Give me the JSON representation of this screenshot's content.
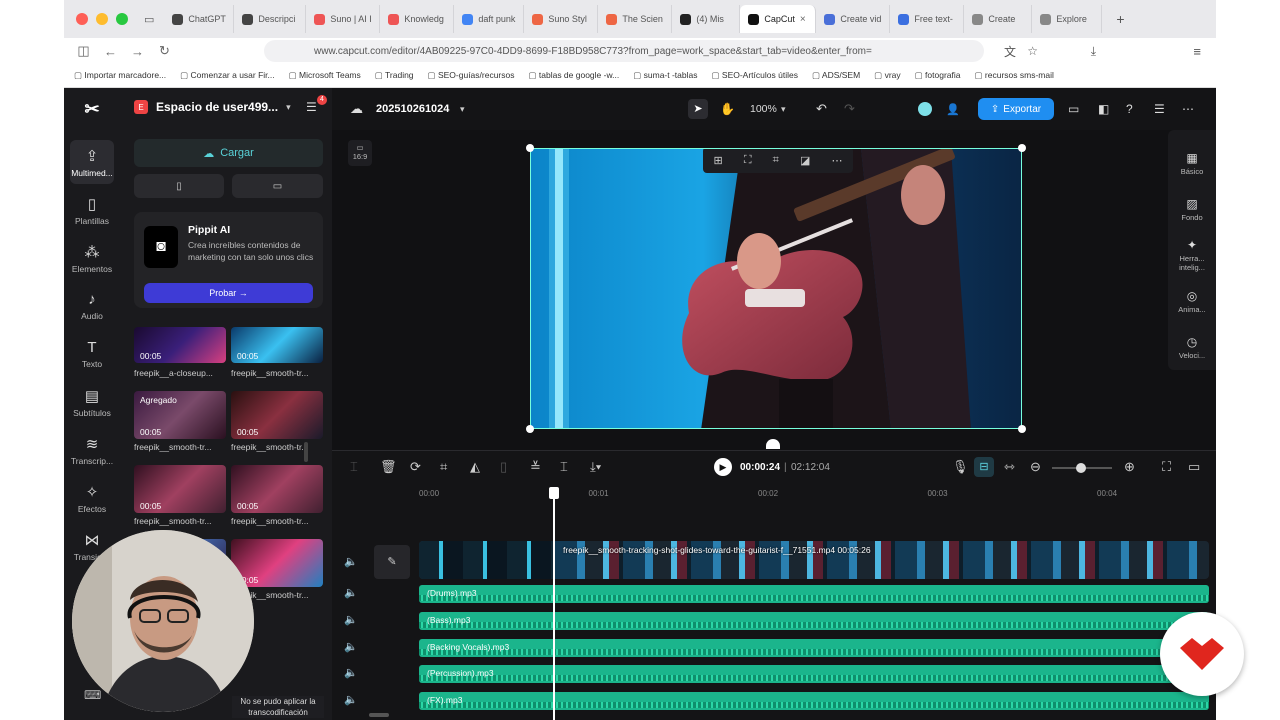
{
  "browser": {
    "tabs": [
      {
        "label": "ChatGPT",
        "color": "#444"
      },
      {
        "label": "Descripci",
        "color": "#444"
      },
      {
        "label": "Suno | AI I",
        "color": "#e55"
      },
      {
        "label": "Knowledg",
        "color": "#e55"
      },
      {
        "label": "daft punk",
        "color": "#4285f4"
      },
      {
        "label": "Suno Styl",
        "color": "#e64"
      },
      {
        "label": "The Scien",
        "color": "#e64"
      },
      {
        "label": "(4)  Mis",
        "color": "#222"
      },
      {
        "label": "CapCut",
        "color": "#111",
        "active": true
      },
      {
        "label": "Create vid",
        "color": "#4a6fd8"
      },
      {
        "label": "Free text-",
        "color": "#3b6fe0"
      },
      {
        "label": "Create",
        "color": "#888"
      },
      {
        "label": "Explore",
        "color": "#888"
      }
    ],
    "url": "www.capcut.com/editor/4AB09225-97C0-4DD9-8699-F18BD958C773?from_page=work_space&start_tab=video&enter_from=",
    "bookmarks": [
      "Importar marcadore...",
      "Comenzar a usar Fir...",
      "Microsoft Teams",
      "Trading",
      "SEO-guías/recursos",
      "tablas de google -w...",
      "suma-t -tablas",
      "SEO-Artículos útiles",
      "ADS/SEM",
      "vray",
      "fotografia",
      "recursos sms-mail"
    ]
  },
  "rail": [
    {
      "icon": "⇪",
      "label": "Multimed...",
      "active": true
    },
    {
      "icon": "▯",
      "label": "Plantillas"
    },
    {
      "icon": "⁂",
      "label": "Elementos"
    },
    {
      "icon": "♪",
      "label": "Audio"
    },
    {
      "icon": "T",
      "label": "Texto"
    },
    {
      "icon": "▤",
      "label": "Subtítulos"
    },
    {
      "icon": "≋",
      "label": "Transcrip..."
    },
    {
      "icon": "✧",
      "label": "Efectos"
    },
    {
      "icon": "⋈",
      "label": "Transici..."
    }
  ],
  "side": {
    "workspace": "Espacio de user499...",
    "badge": "4",
    "upload": "Cargar",
    "promo_title": "Pippit AI",
    "promo_text": "Crea increíbles contenidos de marketing con tan solo unos clics",
    "promo_btn": "Probar →",
    "thumbs": [
      {
        "dur": "00:05",
        "cap": "freepik__a-closeup..."
      },
      {
        "dur": "00:05",
        "cap": "freepik__smooth-tr..."
      },
      {
        "dur": "00:05",
        "cap": "freepik__smooth-tr...",
        "tag": "Agregado"
      },
      {
        "dur": "00:05",
        "cap": "freepik__smooth-tr..."
      },
      {
        "dur": "00:05",
        "cap": "freepik__smooth-tr..."
      },
      {
        "dur": "00:05",
        "cap": "freepik__smooth-tr..."
      },
      {
        "dur": "00:05",
        "cap": "freepik__smooth-tr..."
      },
      {
        "dur": "00:05",
        "cap": "freepik__smooth-tr..."
      }
    ],
    "error": "No se pudo aplicar la transcodificación"
  },
  "topbar": {
    "project": "202510261024",
    "zoom": "100%",
    "export": "Exportar"
  },
  "stage": {
    "ratio": "16:9"
  },
  "rightbar": [
    "Básico",
    "Fondo",
    "Herra... intelig...",
    "Anima...",
    "Veloci..."
  ],
  "timeline": {
    "time": "00:00:24",
    "total": "02:12:04",
    "ticks": [
      "00:00",
      "00:01",
      "00:02",
      "00:03",
      "00:04"
    ],
    "video_clip": "freepik__smooth-tracking-shot-glides-toward-the-guitarist-f__71551.mp4  00:05:26",
    "tracks": [
      "(Drums).mp3",
      "(Bass).mp3",
      "(Backing Vocals).mp3",
      "(Percussion).mp3",
      "(FX).mp3"
    ],
    "playhead": 0.24
  }
}
